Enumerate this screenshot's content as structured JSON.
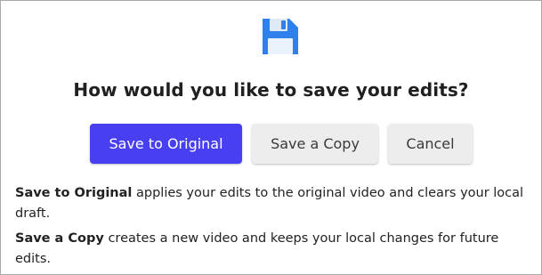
{
  "dialog": {
    "icon": "floppy-disk-icon",
    "title": "How would you like to save your edits?",
    "buttons": {
      "save_original": "Save to Original",
      "save_copy": "Save a Copy",
      "cancel": "Cancel"
    },
    "descriptions": [
      {
        "term": "Save to Original",
        "text": " applies your edits to the original video and clears your local draft."
      },
      {
        "term": "Save a Copy",
        "text": " creates a new video and keeps your local changes for future edits."
      }
    ]
  },
  "colors": {
    "primary": "#4840f0",
    "secondary_bg": "#ededed",
    "icon_blue": "#2f80ed",
    "border": "#a9a9a9"
  }
}
